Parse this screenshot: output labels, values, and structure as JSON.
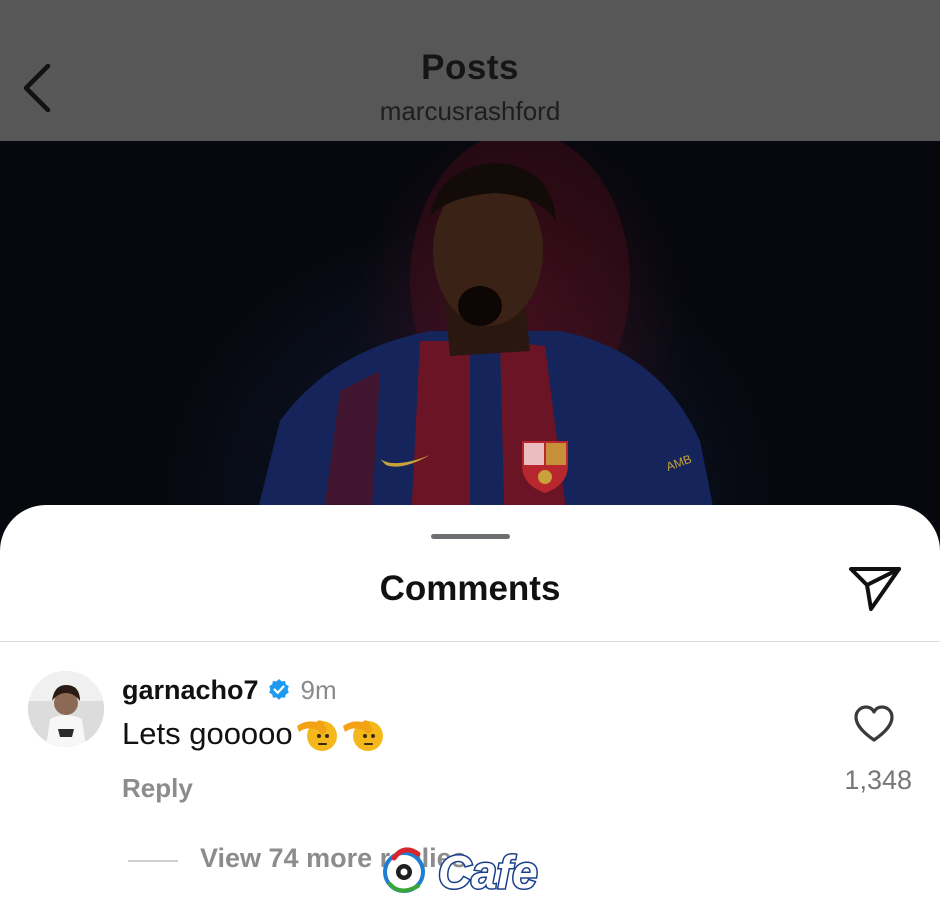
{
  "header": {
    "title": "Posts",
    "subtitle": "marcusrashford",
    "back_icon": "chevron-left-icon"
  },
  "post": {
    "image_description_icon": "photo",
    "jersey_text": "AMB"
  },
  "comments_sheet": {
    "title": "Comments",
    "share_icon": "paper-plane-icon"
  },
  "comment": {
    "username": "garnacho7",
    "verified": true,
    "time": "9m",
    "text": "Lets gooooo",
    "emoji": "🫡",
    "emoji_count": 2,
    "reply_label": "Reply",
    "like_icon": "heart-outline-icon",
    "like_count": "1,348",
    "view_replies_label": "View 74 more replies"
  },
  "watermark": {
    "text": "Cafe"
  },
  "colors": {
    "header_bg": "#575757",
    "verified_blue": "#1d9bf0",
    "muted_text": "#8c8c8c"
  }
}
